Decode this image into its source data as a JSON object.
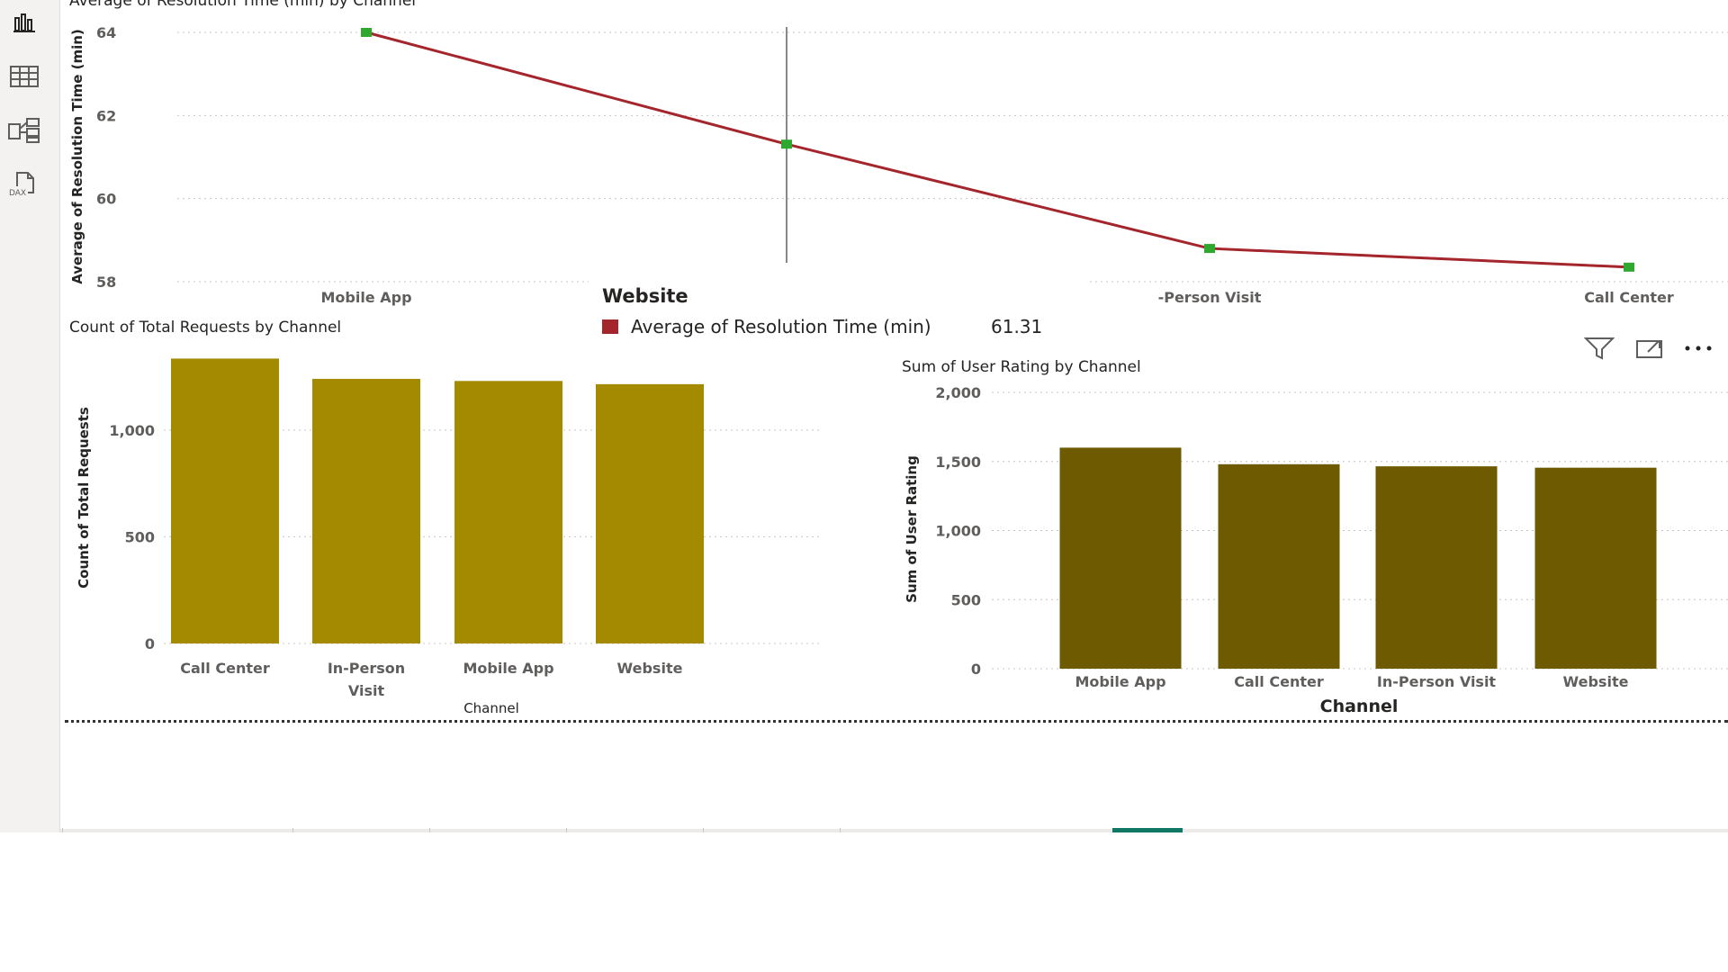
{
  "nav": {
    "items": [
      {
        "icon": "report-view-icon"
      },
      {
        "icon": "table-view-icon"
      },
      {
        "icon": "model-view-icon"
      },
      {
        "icon": "dax-query-view-icon",
        "label": "DAX"
      }
    ]
  },
  "chart_data": [
    {
      "type": "line",
      "title": "Average of Resolution Time (min) by Channel",
      "ylabel": "Average of Resolution Time (min)",
      "categories": [
        "Mobile App",
        "Website",
        "In-Person Visit",
        "Call Center"
      ],
      "tick_labels": [
        "Mobile App",
        "",
        "-Person Visit",
        "Call Center"
      ],
      "values": [
        64.0,
        61.31,
        58.8,
        58.35
      ],
      "ylim": [
        58,
        64
      ],
      "yticks": [
        58,
        60,
        62,
        64
      ],
      "line_color": "#a4262c",
      "marker_color": "#2ea82e",
      "grid": true
    },
    {
      "type": "bar",
      "title": "Count of Total Requests by Channel",
      "xlabel": "Channel",
      "ylabel": "Count of Total Requests",
      "categories": [
        "Call Center",
        "In-Person Visit",
        "Mobile App",
        "Website"
      ],
      "category_lines": [
        [
          "Call Center"
        ],
        [
          "In-Person",
          "Visit"
        ],
        [
          "Mobile App"
        ],
        [
          "Website"
        ]
      ],
      "values": [
        1335,
        1240,
        1230,
        1215
      ],
      "ylim": [
        0,
        1400
      ],
      "yticks": [
        0,
        500,
        1000
      ],
      "ytick_labels": [
        "0",
        "500",
        "1,000"
      ],
      "color": "#a38a00",
      "grid": true
    },
    {
      "type": "bar",
      "title": "Sum of User Rating by Channel",
      "xlabel": "Channel",
      "ylabel": "Sum of User Rating",
      "categories": [
        "Mobile App",
        "Call Center",
        "In-Person Visit",
        "Website"
      ],
      "values": [
        1600,
        1480,
        1465,
        1455
      ],
      "ylim": [
        0,
        2000
      ],
      "yticks": [
        0,
        500,
        1000,
        1500,
        2000
      ],
      "ytick_labels": [
        "0",
        "500",
        "1,000",
        "1,500",
        "2,000"
      ],
      "color": "#6e5a00",
      "grid": true
    }
  ],
  "tooltip": {
    "title": "Website",
    "measure": "Average of Resolution Time (min)",
    "value": "61.31",
    "swatch_color": "#a4262c"
  },
  "visual_header": {
    "icons": [
      "filter-icon",
      "focus-mode-icon",
      "more-options-icon"
    ]
  },
  "page_tabs": {
    "count": 7,
    "active_index": 6
  }
}
